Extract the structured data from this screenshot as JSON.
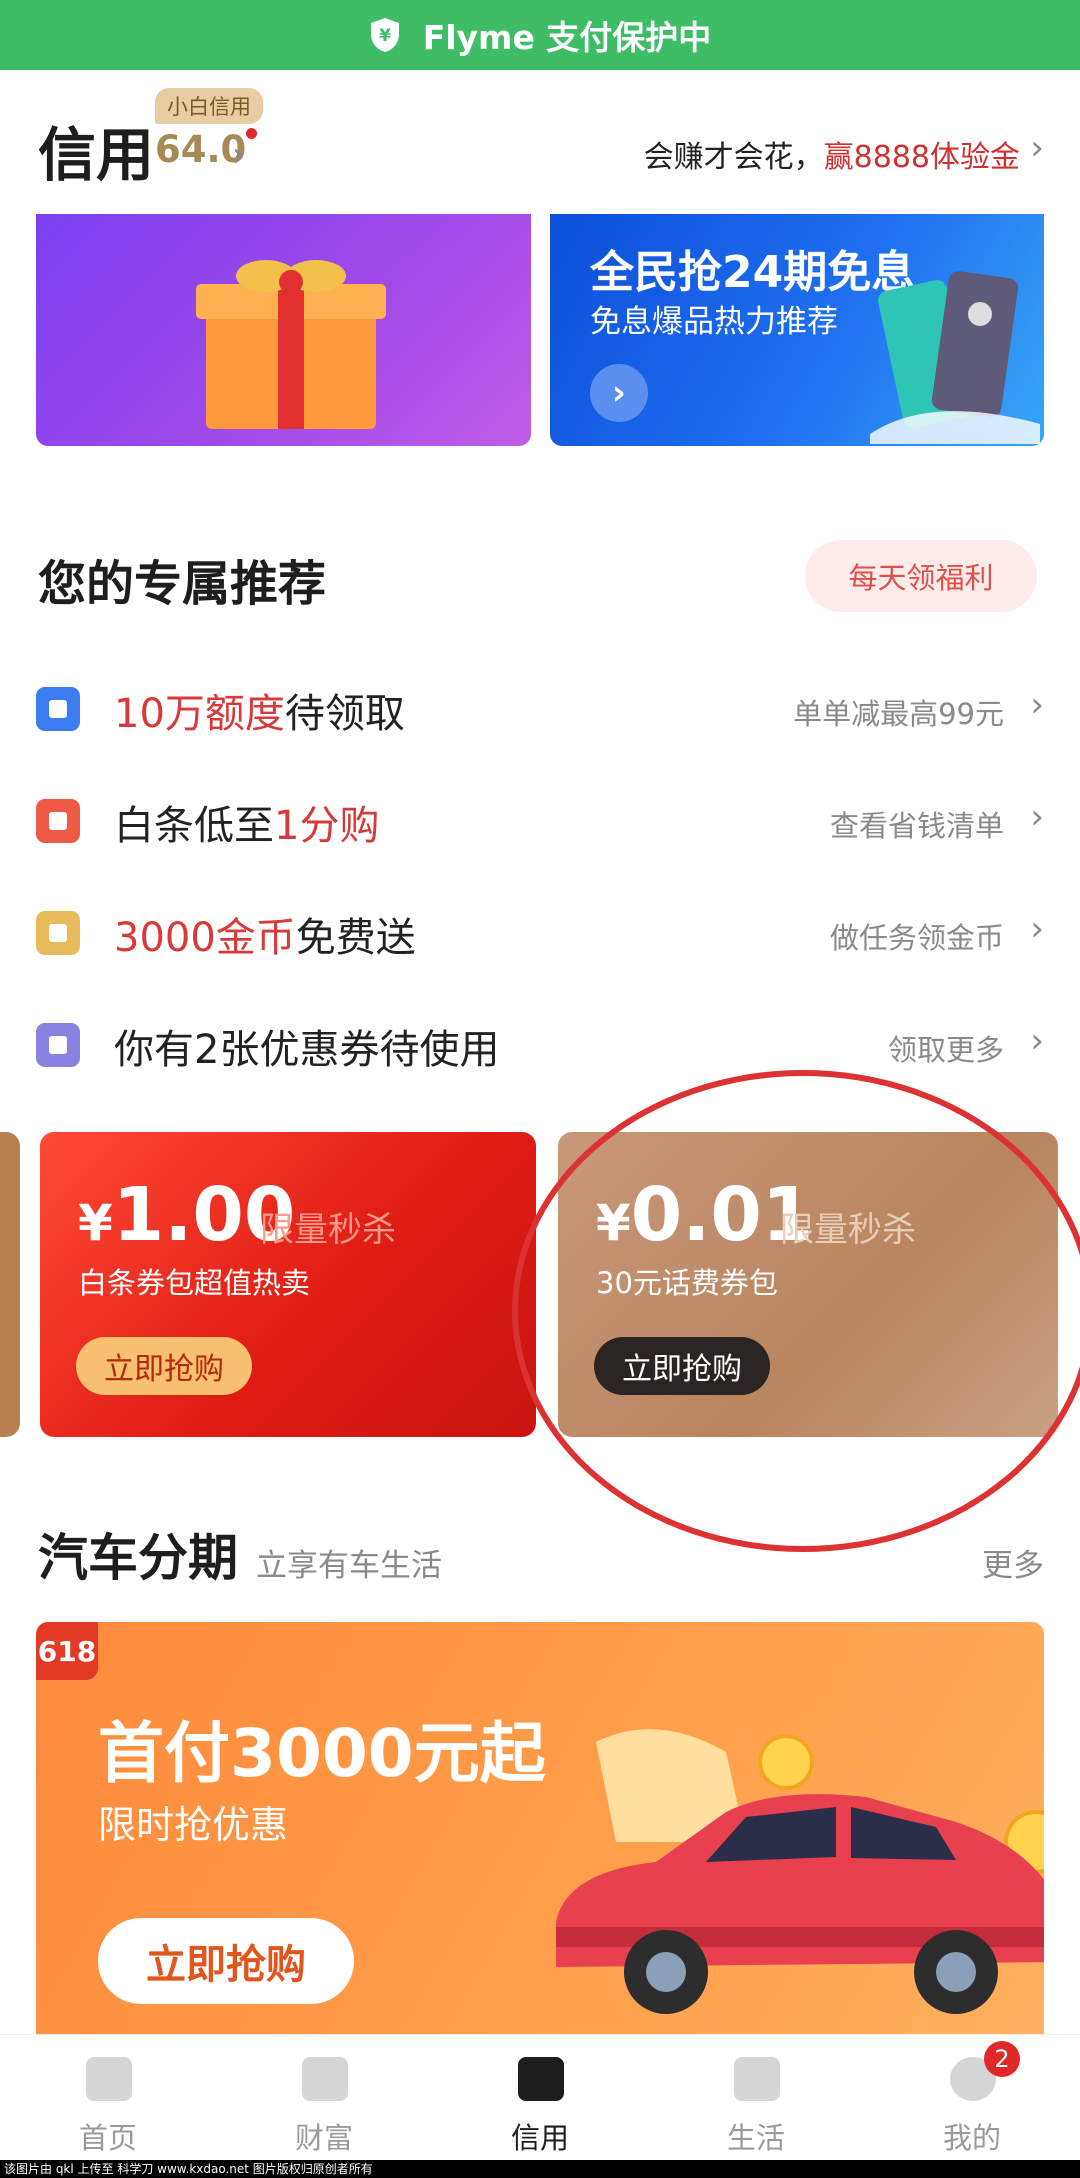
{
  "status_bar": {
    "text": "Flyme 支付保护中"
  },
  "header": {
    "title": "信用",
    "badge": "小白信用",
    "score": "64.0",
    "promo_prefix": "会赚才会花，",
    "promo_highlight": "赢8888体验金"
  },
  "banners": {
    "right_title": "全民抢24期免息",
    "right_subtitle": "免息爆品热力推荐"
  },
  "recommend": {
    "title": "您的专属推荐",
    "daily_button": "每天领福利",
    "rows": [
      {
        "hl_first": true,
        "hl": "10万额度",
        "text": "待领取",
        "right": "单单减最高99元",
        "icon": "bag-icon",
        "color": "#3b7cf0"
      },
      {
        "hl_first": false,
        "pre": "白条低至",
        "hl": "1分购",
        "right": "查看省钱清单",
        "icon": "card-icon",
        "color": "#ee5a45"
      },
      {
        "hl_first": true,
        "hl": "3000金币",
        "text": "免费送",
        "right": "做任务领金币",
        "icon": "coin-icon",
        "color": "#e7bb5a"
      },
      {
        "hl_first": false,
        "pre": "你有2张优惠券待使用",
        "hl": "",
        "right": "领取更多",
        "icon": "gift-icon",
        "color": "#8a82e0"
      }
    ]
  },
  "coupons": [
    {
      "yen": "¥",
      "price": "1.00",
      "tag": "限量秒杀",
      "desc": "白条券包超值热卖",
      "button": "立即抢购"
    },
    {
      "yen": "¥",
      "price": "0.01",
      "tag": "限量秒杀",
      "desc": "30元话费券包",
      "button": "立即抢购"
    }
  ],
  "car_loan": {
    "title": "汽车分期",
    "subtitle": "立享有车生活",
    "more": "更多",
    "tag": "618",
    "banner_title": "首付3000元起",
    "banner_subtitle": "限时抢优惠",
    "banner_button": "立即抢购"
  },
  "nav": {
    "items": [
      "首页",
      "财富",
      "信用",
      "生活",
      "我的"
    ],
    "active": "信用",
    "badge": "2"
  },
  "watermark": "该图片由 qkl 上传至 科学刀 www.kxdao.net 图片版权归原创者所有"
}
